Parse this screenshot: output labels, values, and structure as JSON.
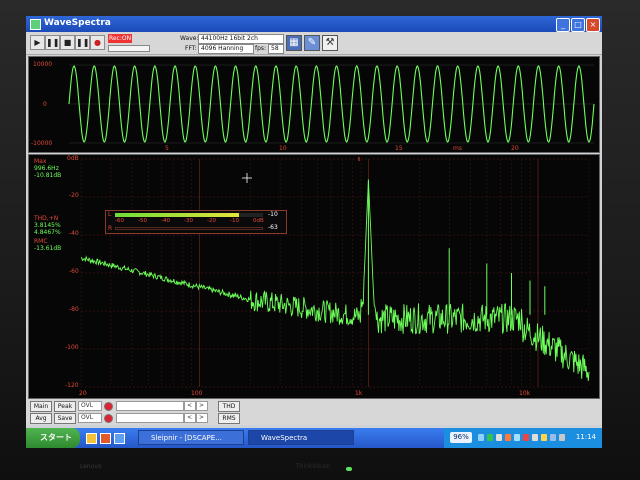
{
  "window": {
    "title": "WaveSpectra",
    "min": "_",
    "max": "□",
    "close": "×"
  },
  "toolbar": {
    "play_icon": "▶",
    "pause_icon": "❚❚",
    "stop_icon": "■",
    "record_icon": "●",
    "rec_badge": "Rec:ON",
    "wave_label": "Wave:",
    "wave_value": "44100Hz 16bit 2ch",
    "fft_label": "FFT:",
    "fft_value": "4096 Hanning",
    "fps_label": "fps:",
    "fps_value": "58",
    "tool_icons": [
      "grid-icon",
      "pen-icon",
      "wrench-icon"
    ]
  },
  "wave": {
    "y_labels": [
      "10000",
      "0",
      "-10000"
    ],
    "x_ticks": [
      "5",
      "10",
      "15",
      "20"
    ],
    "x_unit": "ms",
    "cycles": 26
  },
  "spectrum": {
    "peak_info": [
      "Max",
      "996.6Hz",
      "-10.81dB"
    ],
    "thd_info": [
      "THD,+N",
      "3.8145%",
      "4.8467%"
    ],
    "rms_info": [
      "RMC",
      "-13.61dB"
    ],
    "y_labels": [
      "0dB",
      "-20",
      "-40",
      "-60",
      "-80",
      "-100",
      "-120"
    ],
    "x_labels": [
      "20",
      "100",
      "1k",
      "10k"
    ],
    "meter": {
      "scale": [
        "-60",
        "-50",
        "-40",
        "-30",
        "-20",
        "-10",
        "0dB"
      ],
      "left_value": "-10",
      "right_value": "-63",
      "left_label": "L",
      "right_label": "R",
      "left_level": 0.84
    },
    "fundamental_hz": 996.6,
    "fundamental_db": -10.81
  },
  "bottom": {
    "main_label": "Main",
    "avg_label": "Avg",
    "peak_label": "Peak",
    "save_label": "Save",
    "ovl_label": "OVL",
    "thd_btn": "THD",
    "rms_btn": "RMS",
    "arrow_labels": [
      "<",
      ">"
    ]
  },
  "taskbar": {
    "start_label": "スタート",
    "tasks": [
      "Sleipnir - [DSCAPE...",
      "WaveSpectra"
    ],
    "percent": "96%",
    "clock": "11:14"
  },
  "brand": {
    "left": "Lenovo",
    "right": "ThinkVision"
  }
}
